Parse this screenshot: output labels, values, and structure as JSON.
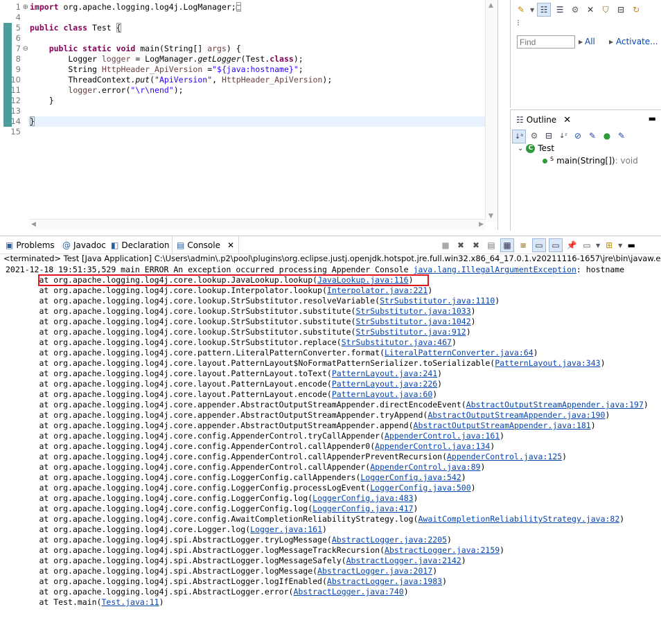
{
  "editor": {
    "lines": [
      {
        "num": "1",
        "fold": "⊕",
        "mark": false,
        "cur": false,
        "segments": [
          [
            "kw",
            "import"
          ],
          [
            "",
            " org.apache.logging.log4j.LogManager;"
          ],
          [
            "box",
            "□"
          ]
        ]
      },
      {
        "num": "4",
        "fold": "",
        "mark": false,
        "cur": false,
        "segments": []
      },
      {
        "num": "5",
        "fold": "",
        "mark": true,
        "cur": false,
        "segments": [
          [
            "kw",
            "public class"
          ],
          [
            "",
            " Test "
          ],
          [
            "box",
            "{"
          ]
        ]
      },
      {
        "num": "6",
        "fold": "",
        "mark": true,
        "cur": false,
        "segments": []
      },
      {
        "num": "7",
        "fold": "⊖",
        "mark": true,
        "cur": false,
        "segments": [
          [
            "",
            "    "
          ],
          [
            "kw",
            "public static void"
          ],
          [
            "",
            " main(String[] "
          ],
          [
            "var",
            "args"
          ],
          [
            "",
            ") {"
          ]
        ]
      },
      {
        "num": "8",
        "fold": "",
        "mark": true,
        "cur": false,
        "segments": [
          [
            "",
            "        Logger "
          ],
          [
            "var",
            "logger"
          ],
          [
            "",
            " = LogManager."
          ],
          [
            "it",
            "getLogger"
          ],
          [
            "",
            "(Test."
          ],
          [
            "kw",
            "class"
          ],
          [
            "",
            ");"
          ]
        ]
      },
      {
        "num": "9",
        "fold": "",
        "mark": true,
        "cur": false,
        "segments": [
          [
            "",
            "        String "
          ],
          [
            "var",
            "HttpHeader_ApiVersion"
          ],
          [
            "",
            " ="
          ],
          [
            "str",
            "\"${java:hostname}\""
          ],
          [
            "",
            ";"
          ]
        ]
      },
      {
        "num": "10",
        "fold": "",
        "mark": true,
        "cur": false,
        "segments": [
          [
            "",
            "        ThreadContext."
          ],
          [
            "it",
            "put"
          ],
          [
            "",
            "("
          ],
          [
            "str",
            "\"ApiVersion\""
          ],
          [
            "",
            ", "
          ],
          [
            "var",
            "HttpHeader_ApiVersion"
          ],
          [
            "",
            ");"
          ]
        ]
      },
      {
        "num": "11",
        "fold": "",
        "mark": true,
        "cur": false,
        "segments": [
          [
            "",
            "        "
          ],
          [
            "var",
            "logger"
          ],
          [
            "",
            ".error("
          ],
          [
            "str",
            "\"\\r\\nend\""
          ],
          [
            "",
            ");"
          ]
        ]
      },
      {
        "num": "12",
        "fold": "",
        "mark": true,
        "cur": false,
        "segments": [
          [
            "",
            "    }"
          ]
        ]
      },
      {
        "num": "13",
        "fold": "",
        "mark": true,
        "cur": false,
        "segments": []
      },
      {
        "num": "14",
        "fold": "",
        "mark": true,
        "cur": true,
        "segments": [
          [
            "box",
            "}"
          ]
        ]
      },
      {
        "num": "15",
        "fold": "",
        "mark": false,
        "cur": false,
        "segments": []
      }
    ]
  },
  "task_pane": {
    "find_placeholder": "Find",
    "all_label": "All",
    "activate_label": "Activate..."
  },
  "outline": {
    "tab_label": "Outline",
    "class_name": "Test",
    "method_name": "main(String[])",
    "method_type": " : void"
  },
  "console": {
    "tabs": {
      "problems": "Problems",
      "javadoc": "Javadoc",
      "declaration": "Declaration",
      "console": "Console"
    },
    "title": "<terminated> Test [Java Application] C:\\Users\\admin\\.p2\\pool\\plugins\\org.eclipse.justj.openjdk.hotspot.jre.full.win32.x86_64_17.0.1.v20211116-1657\\jre\\bin\\javaw.exe",
    "first_line_prefix": "2021-12-18 19:51:35,529 main ERROR An exception occurred processing Appender Console ",
    "first_line_link": "java.lang.IllegalArgumentException",
    "first_line_suffix": ": hostname",
    "frames": [
      {
        "method": "org.apache.logging.log4j.core.lookup.JavaLookup.lookup",
        "link": "JavaLookup.java:116"
      },
      {
        "method": "org.apache.logging.log4j.core.lookup.Interpolator.lookup",
        "link": "Interpolator.java:221"
      },
      {
        "method": "org.apache.logging.log4j.core.lookup.StrSubstitutor.resolveVariable",
        "link": "StrSubstitutor.java:1110"
      },
      {
        "method": "org.apache.logging.log4j.core.lookup.StrSubstitutor.substitute",
        "link": "StrSubstitutor.java:1033"
      },
      {
        "method": "org.apache.logging.log4j.core.lookup.StrSubstitutor.substitute",
        "link": "StrSubstitutor.java:1042"
      },
      {
        "method": "org.apache.logging.log4j.core.lookup.StrSubstitutor.substitute",
        "link": "StrSubstitutor.java:912"
      },
      {
        "method": "org.apache.logging.log4j.core.lookup.StrSubstitutor.replace",
        "link": "StrSubstitutor.java:467"
      },
      {
        "method": "org.apache.logging.log4j.core.pattern.LiteralPatternConverter.format",
        "link": "LiteralPatternConverter.java:64"
      },
      {
        "method": "org.apache.logging.log4j.core.layout.PatternLayout$NoFormatPatternSerializer.toSerializable",
        "link": "PatternLayout.java:343"
      },
      {
        "method": "org.apache.logging.log4j.core.layout.PatternLayout.toText",
        "link": "PatternLayout.java:241"
      },
      {
        "method": "org.apache.logging.log4j.core.layout.PatternLayout.encode",
        "link": "PatternLayout.java:226"
      },
      {
        "method": "org.apache.logging.log4j.core.layout.PatternLayout.encode",
        "link": "PatternLayout.java:60"
      },
      {
        "method": "org.apache.logging.log4j.core.appender.AbstractOutputStreamAppender.directEncodeEvent",
        "link": "AbstractOutputStreamAppender.java:197"
      },
      {
        "method": "org.apache.logging.log4j.core.appender.AbstractOutputStreamAppender.tryAppend",
        "link": "AbstractOutputStreamAppender.java:190"
      },
      {
        "method": "org.apache.logging.log4j.core.appender.AbstractOutputStreamAppender.append",
        "link": "AbstractOutputStreamAppender.java:181"
      },
      {
        "method": "org.apache.logging.log4j.core.config.AppenderControl.tryCallAppender",
        "link": "AppenderControl.java:161"
      },
      {
        "method": "org.apache.logging.log4j.core.config.AppenderControl.callAppender0",
        "link": "AppenderControl.java:134"
      },
      {
        "method": "org.apache.logging.log4j.core.config.AppenderControl.callAppenderPreventRecursion",
        "link": "AppenderControl.java:125"
      },
      {
        "method": "org.apache.logging.log4j.core.config.AppenderControl.callAppender",
        "link": "AppenderControl.java:89"
      },
      {
        "method": "org.apache.logging.log4j.core.config.LoggerConfig.callAppenders",
        "link": "LoggerConfig.java:542"
      },
      {
        "method": "org.apache.logging.log4j.core.config.LoggerConfig.processLogEvent",
        "link": "LoggerConfig.java:500"
      },
      {
        "method": "org.apache.logging.log4j.core.config.LoggerConfig.log",
        "link": "LoggerConfig.java:483"
      },
      {
        "method": "org.apache.logging.log4j.core.config.LoggerConfig.log",
        "link": "LoggerConfig.java:417"
      },
      {
        "method": "org.apache.logging.log4j.core.config.AwaitCompletionReliabilityStrategy.log",
        "link": "AwaitCompletionReliabilityStrategy.java:82"
      },
      {
        "method": "org.apache.logging.log4j.core.Logger.log",
        "link": "Logger.java:161"
      },
      {
        "method": "org.apache.logging.log4j.spi.AbstractLogger.tryLogMessage",
        "link": "AbstractLogger.java:2205"
      },
      {
        "method": "org.apache.logging.log4j.spi.AbstractLogger.logMessageTrackRecursion",
        "link": "AbstractLogger.java:2159"
      },
      {
        "method": "org.apache.logging.log4j.spi.AbstractLogger.logMessageSafely",
        "link": "AbstractLogger.java:2142"
      },
      {
        "method": "org.apache.logging.log4j.spi.AbstractLogger.logMessage",
        "link": "AbstractLogger.java:2017"
      },
      {
        "method": "org.apache.logging.log4j.spi.AbstractLogger.logIfEnabled",
        "link": "AbstractLogger.java:1983"
      },
      {
        "method": "org.apache.logging.log4j.spi.AbstractLogger.error",
        "link": "AbstractLogger.java:740"
      },
      {
        "method": "Test.main",
        "link": "Test.java:11"
      }
    ]
  },
  "colors": {
    "keyword": "#7f0055",
    "string": "#2a00ff",
    "link": "#0645ad",
    "highlight_box": "#e2141c",
    "change_marker": "#4a9e9e"
  }
}
